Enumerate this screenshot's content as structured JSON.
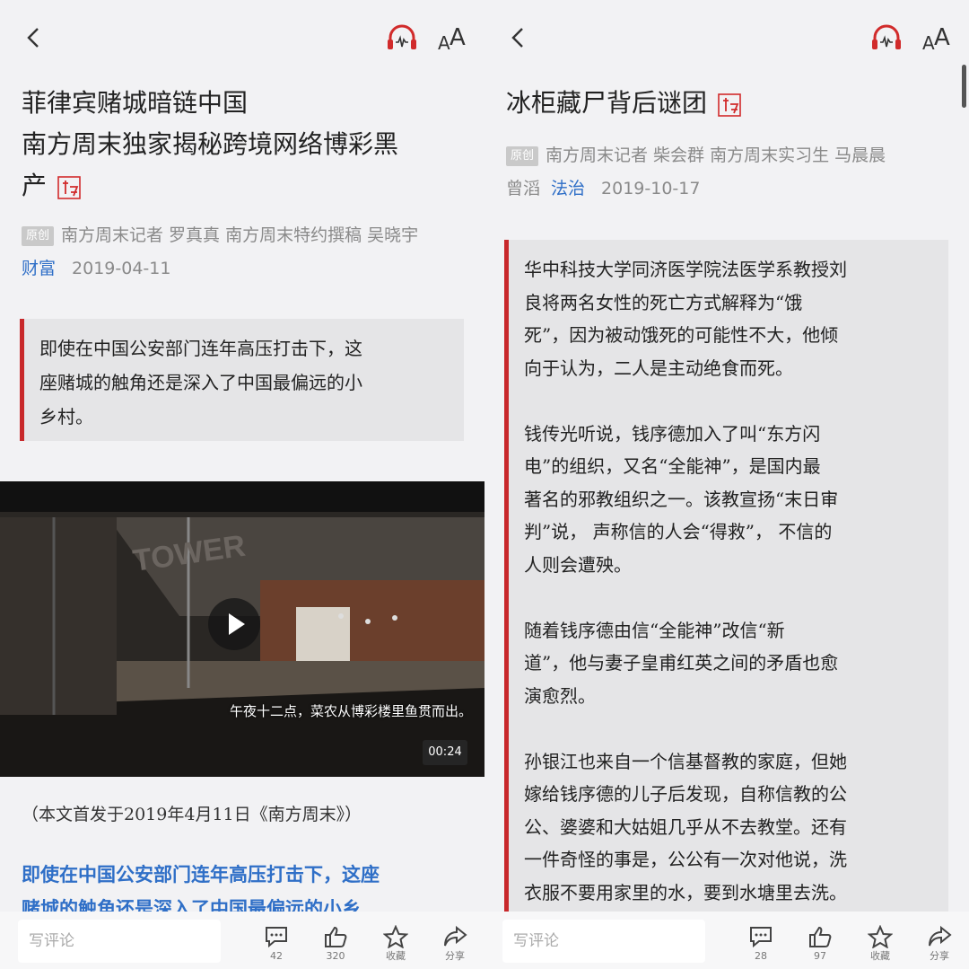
{
  "colors": {
    "accent_red": "#c8282b",
    "link_blue": "#2f6fc7",
    "background": "#f2f2f4"
  },
  "left": {
    "topbar": {
      "font_size_small": "A",
      "font_size_large": "A"
    },
    "title_lines": [
      "菲律宾赌城暗链中国",
      "南方周末独家揭秘跨境网络博彩黑",
      "产"
    ],
    "meta": {
      "badge": "原创",
      "authors": "南方周末记者 罗真真 南方周末特约撰稿 吴晓宇",
      "category": "财富",
      "date": "2019-04-11"
    },
    "quote_lines": [
      "即使在中国公安部门连年高压打击下，这",
      "座赌城的触角还是深入了中国最偏远的小",
      "乡村。"
    ],
    "video": {
      "sign": "TOWER",
      "caption": "午夜十二点，菜农从博彩楼里鱼贯而出。",
      "duration": "00:24"
    },
    "source_note": "（本文首发于2019年4月11日《南方周末》）",
    "lede_lines": [
      "即使在中国公安部门连年高压打击下，这座",
      "赌城的触角还是深入了中国最偏远的小乡"
    ],
    "bottom": {
      "comment_placeholder": "写评论",
      "comment_count": "42",
      "like_count": "320",
      "favorite_label": "收藏",
      "share_label": "分享"
    }
  },
  "right": {
    "topbar": {
      "font_size_small": "A",
      "font_size_large": "A"
    },
    "title_lines": [
      "冰柜藏尸背后谜团"
    ],
    "meta": {
      "badge": "原创",
      "authors": "南方周末记者 柴会群 南方周末实习生 马晨晨",
      "authors_cont": "曾滔",
      "category": "法治",
      "date": "2019-10-17"
    },
    "quote_paragraphs": [
      [
        "华中科技大学同济医学院法医学系教授刘",
        "良将两名女性的死亡方式解释为“饿",
        "死”，因为被动饿死的可能性不大，他倾",
        "向于认为，二人是主动绝食而死。"
      ],
      [
        "钱传光听说，钱序德加入了叫“东方闪",
        "电”的组织，又名“全能神”，是国内最",
        "著名的邪教组织之一。该教宣扬“末日审",
        "判”说，  声称信的人会“得救”，  不信的",
        "人则会遭殃。"
      ],
      [
        "随着钱序德由信“全能神”改信“新",
        "道”，他与妻子皇甫红英之间的矛盾也愈",
        "演愈烈。"
      ],
      [
        "孙银江也来自一个信基督教的家庭，但她",
        "嫁给钱序德的儿子后发现，自称信教的公",
        "公、婆婆和大姑姐几乎从不去教堂。还有",
        "一件奇怪的事是，公公有一次对他说，洗",
        "衣服不要用家里的水，要到水塘里去洗。"
      ]
    ],
    "bottom": {
      "comment_placeholder": "写评论",
      "comment_count": "28",
      "like_count": "97",
      "favorite_label": "收藏",
      "share_label": "分享"
    }
  }
}
